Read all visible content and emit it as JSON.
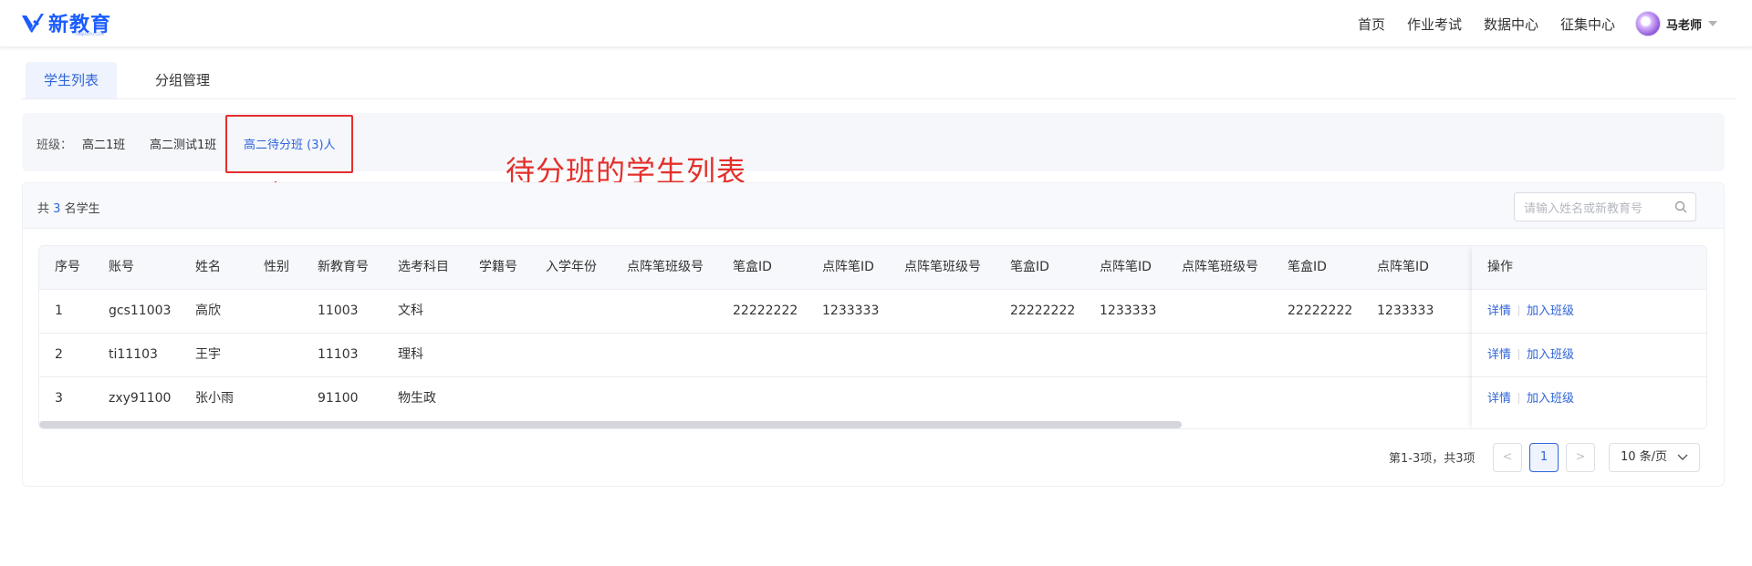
{
  "brand": {
    "name": "新教育",
    "tagline": "XINJIAOYU.COM"
  },
  "nav": {
    "items": [
      "首页",
      "作业考试",
      "数据中心",
      "征集中心"
    ]
  },
  "user": {
    "name": "马老师"
  },
  "tabs": [
    "学生列表",
    "分组管理"
  ],
  "classes": {
    "label": "班级：",
    "options": [
      "高二1班",
      "高二测试1班",
      "高二待分班 (3)人"
    ],
    "active_index": 2
  },
  "annotation": "待分班的学生列表",
  "summary": {
    "prefix": "共",
    "count": "3",
    "suffix": "名学生"
  },
  "search": {
    "placeholder": "请输入姓名或新教育号",
    "icon": "search-icon"
  },
  "table": {
    "headers": [
      "序号",
      "账号",
      "姓名",
      "性别",
      "新教育号",
      "选考科目",
      "学籍号",
      "入学年份",
      "点阵笔班级号",
      "笔盒ID",
      "点阵笔ID",
      "点阵笔班级号",
      "笔盒ID",
      "点阵笔ID",
      "点阵笔班级号",
      "笔盒ID",
      "点阵笔ID",
      "操作"
    ],
    "rows": [
      [
        "1",
        "gcs11003",
        "高欣",
        "",
        "11003",
        "文科",
        "",
        "",
        "",
        "22222222",
        "1233333",
        "",
        "22222222",
        "1233333",
        "",
        "22222222",
        "1233333"
      ],
      [
        "2",
        "ti11103",
        "王宇",
        "",
        "11103",
        "理科",
        "",
        "",
        "",
        "",
        "",
        "",
        "",
        "",
        "",
        "",
        ""
      ],
      [
        "3",
        "zxy91100",
        "张小雨",
        "",
        "91100",
        "物生政",
        "",
        "",
        "",
        "",
        "",
        "",
        "",
        "",
        "",
        "",
        ""
      ]
    ],
    "actions": {
      "detail": "详情",
      "join": "加入班级"
    }
  },
  "pagination": {
    "range_text": "第1-3项，共3项",
    "current_page": "1",
    "prev": "<",
    "next": ">",
    "page_size": "10 条/页"
  },
  "colors": {
    "accent": "#2f65d8",
    "annotation": "#e4302b"
  }
}
